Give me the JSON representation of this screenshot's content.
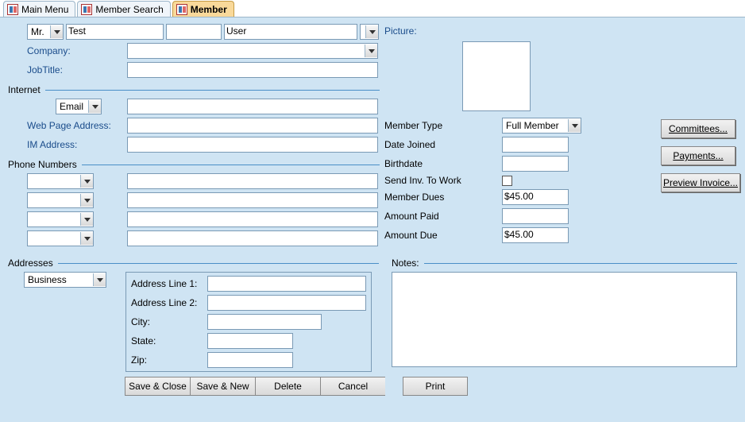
{
  "tabs": {
    "main_menu": "Main Menu",
    "member_search": "Member Search",
    "member": "Member"
  },
  "name": {
    "title": "Mr.",
    "first": "Test",
    "middle": "",
    "last": "User",
    "suffix": ""
  },
  "labels": {
    "company": "Company:",
    "job_title": "JobTitle:",
    "internet": "Internet",
    "email": "Email",
    "web_page": "Web Page Address:",
    "im": "IM Address:",
    "phone_numbers": "Phone Numbers",
    "addresses": "Addresses",
    "address_type": "Business",
    "addr1": "Address Line 1:",
    "addr2": "Address Line 2:",
    "city": "City:",
    "state": "State:",
    "zip": "Zip:",
    "picture": "Picture:",
    "member_type": "Member Type",
    "date_joined": "Date Joined",
    "birthdate": "Birthdate",
    "send_inv": "Send Inv. To Work",
    "member_dues": "Member Dues",
    "amount_paid": "Amount Paid",
    "amount_due": "Amount Due",
    "notes": "Notes:"
  },
  "values": {
    "company": "",
    "job_title": "",
    "email_addr": "",
    "web_page": "",
    "im": "",
    "member_type": "Full Member",
    "date_joined": "",
    "birthdate": "",
    "member_dues": "$45.00",
    "amount_paid": "",
    "amount_due": "$45.00",
    "notes": "",
    "addr1": "",
    "addr2": "",
    "city": "",
    "state": "",
    "zip": ""
  },
  "buttons": {
    "committees": "Committees...",
    "payments": "Payments...",
    "preview_invoice": "Preview Invoice...",
    "save_close": "Save & Close",
    "save_new": "Save & New",
    "delete": "Delete",
    "cancel": "Cancel",
    "print": "Print"
  }
}
